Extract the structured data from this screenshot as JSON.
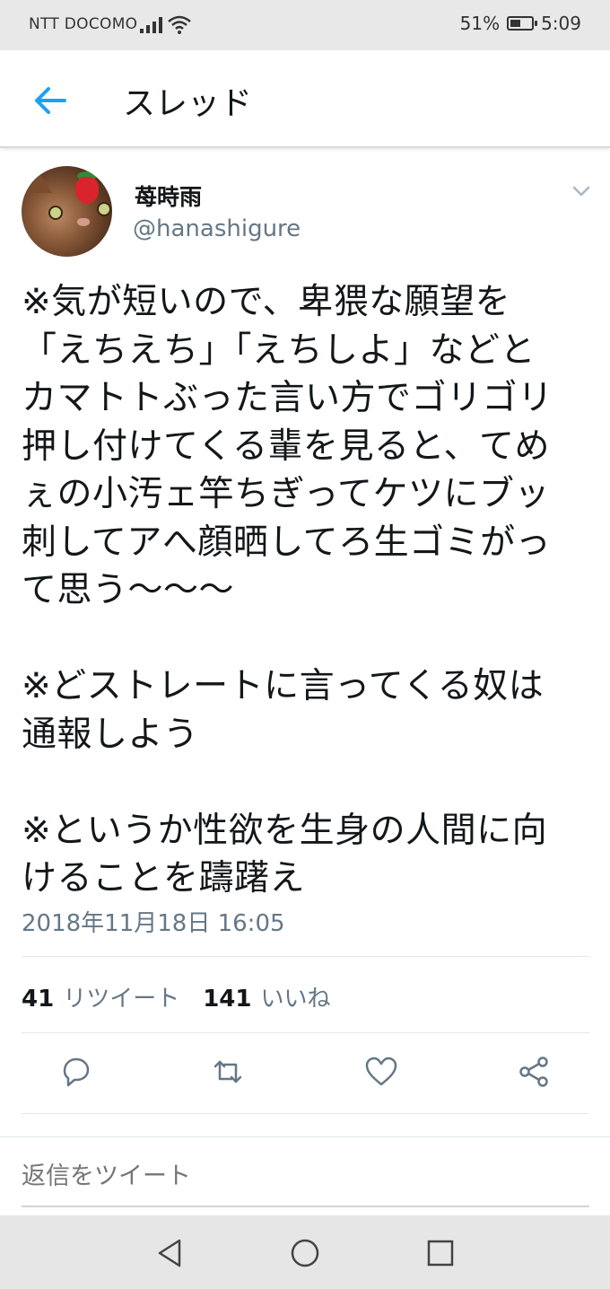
{
  "status_bar": {
    "carrier": "NTT DOCOMO",
    "battery_percent": "51%",
    "battery_level": 0.51,
    "time": "5:09"
  },
  "header": {
    "title": "スレッド"
  },
  "tweet": {
    "display_name": "苺時雨",
    "handle": "@hanashigure",
    "text": "※気が短いので、卑猥な願望を\n「えちえち」「えちしよ」などと\nカマトトぶった言い方でゴリゴリ\n押し付けてくる輩を見ると、てめ\nぇの小汚ェ竿ちぎってケツにブッ\n刺してアへ顔晒してろ生ゴミがっ\nて思う〜〜〜\n\n※どストレートに言ってくる奴は\n通報しよう\n\n※というか性欲を生身の人間に向\nけることを躊躇え",
    "timestamp": "2018年11月18日 16:05",
    "retweet_count": "41",
    "retweet_label": "リツイート",
    "like_count": "141",
    "like_label": "いいね"
  },
  "reply": {
    "placeholder": "返信をツイート"
  },
  "colors": {
    "accent": "#1da1f2",
    "secondary_text": "#657786",
    "icon_gray": "#657786"
  }
}
